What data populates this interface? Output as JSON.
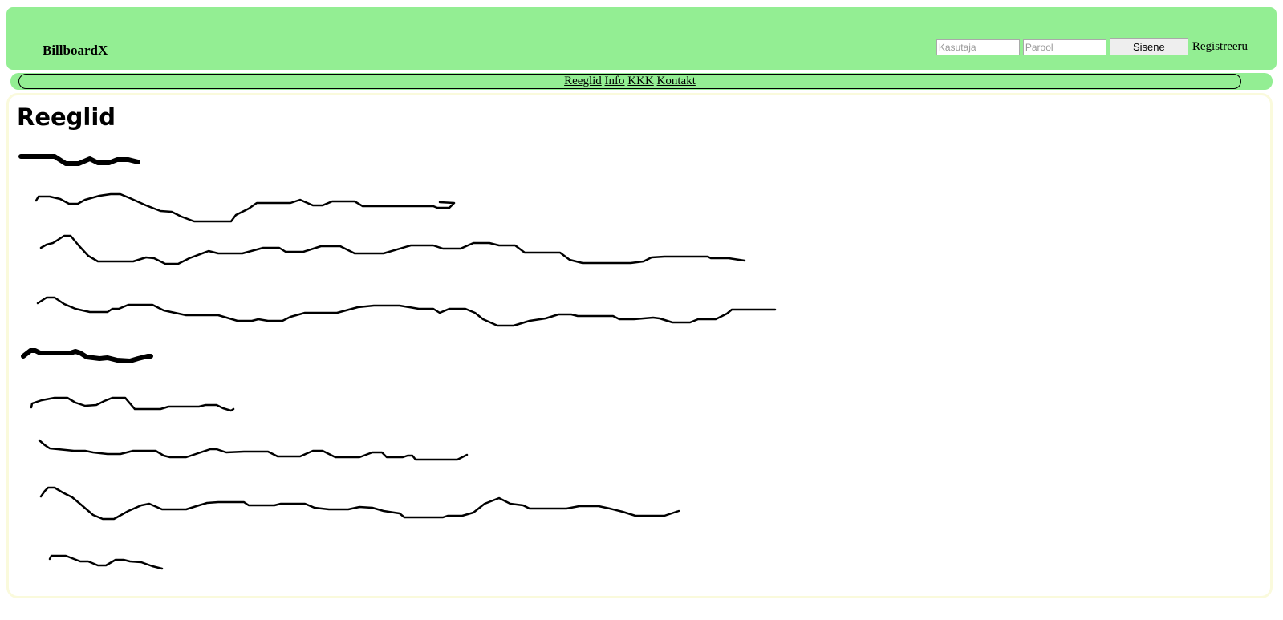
{
  "header": {
    "logo": "BillboardX",
    "login": {
      "username_placeholder": "Kasutaja",
      "password_placeholder": "Parool",
      "submit_label": "Sisene",
      "register_label": "Registreeru"
    },
    "background_color": "#93ee93"
  },
  "nav": {
    "items": [
      {
        "label": "Reeglid"
      },
      {
        "label": "Info"
      },
      {
        "label": "KKK"
      },
      {
        "label": "Kontakt"
      }
    ]
  },
  "main": {
    "title": "Reeglid"
  }
}
